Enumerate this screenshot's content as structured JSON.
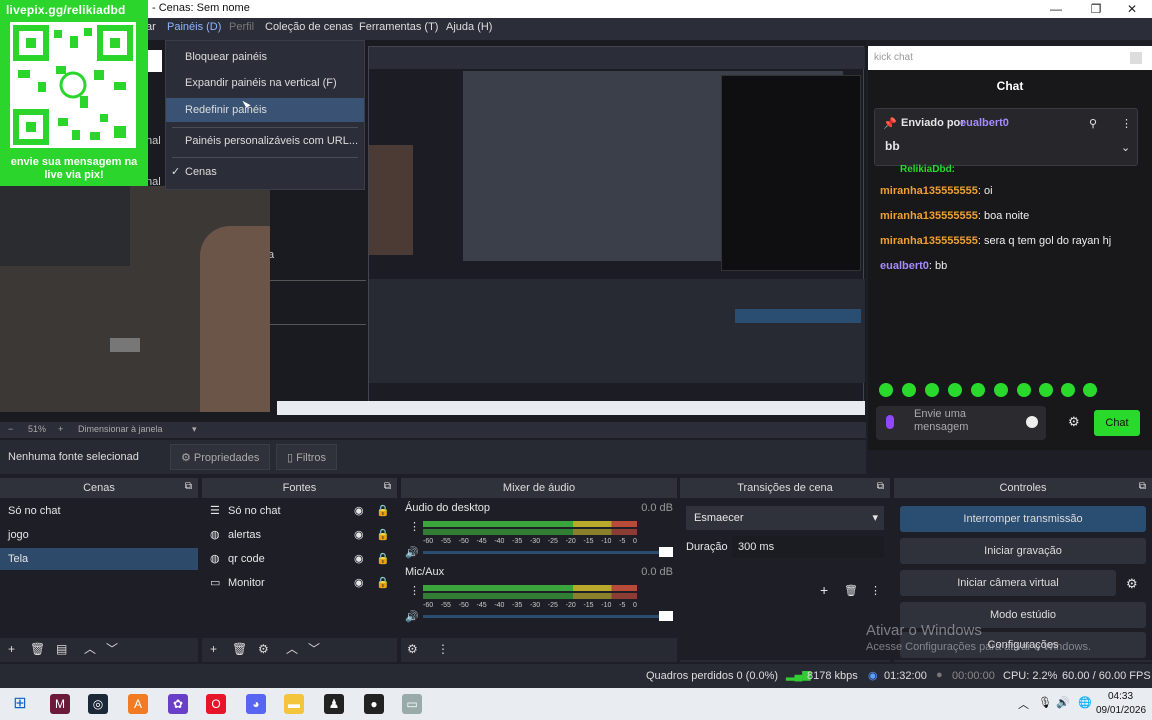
{
  "window": {
    "title": "- Cenas: Sem nome",
    "minimize": "—",
    "maximize": "❐",
    "close": "✕"
  },
  "menubar": {
    "items": [
      "ar",
      "Painéis (D)",
      "Perfil",
      "Coleção de cenas",
      "Ferramentas (T)",
      "Ajuda (H)"
    ]
  },
  "paneis_menu": {
    "items": [
      "Bloquear painéis",
      "Expandir painéis na vertical (F)",
      "Redefinir painéis",
      "Painéis personalizáveis com URL...",
      "Cenas"
    ],
    "check": "✓"
  },
  "qr_overlay": {
    "url": "livepix.gg/relikiadbd",
    "message": "envie sua mensagem na live via pix!"
  },
  "preview": {
    "left_labels": [
      "nal",
      "nal",
      "a"
    ]
  },
  "chat": {
    "search": "kick chat",
    "title": "Chat",
    "pinned_prefix": "Enviado por",
    "pinned_user": "eualbert0",
    "pinned_text": "bb",
    "partial_user": "RelikiaDbd:",
    "messages": [
      {
        "user": "miranha135555555",
        "text": ": oi",
        "color": "#f0a030"
      },
      {
        "user": "miranha135555555",
        "text": ": boa noite",
        "color": "#f0a030"
      },
      {
        "user": "miranha135555555",
        "text": ": sera q tem gol do rayan hj",
        "color": "#f0a030"
      },
      {
        "user": "eualbert0",
        "text": ": bb",
        "color": "#a58bff"
      }
    ],
    "input_placeholder": "Envie uma mensagem",
    "send": "Chat"
  },
  "zoom": {
    "minus": "−",
    "value": "51%",
    "plus": "+",
    "mode": "Dimensionar à janela"
  },
  "source_bar": {
    "status": "Nenhuma fonte selecionad",
    "properties": "Propriedades",
    "filters": "Filtros"
  },
  "scenes": {
    "title": "Cenas",
    "items": [
      "Só no chat",
      "jogo",
      "Tela"
    ]
  },
  "sources": {
    "title": "Fontes",
    "items": [
      "Só no chat",
      "alertas",
      "qr code",
      "Monitor"
    ]
  },
  "mixer": {
    "title": "Mixer de áudio",
    "channels": [
      {
        "name": "Áudio do desktop",
        "db": "0.0 dB",
        "level": 0.54
      },
      {
        "name": "Mic/Aux",
        "db": "0.0 dB",
        "level": 0.44
      }
    ],
    "ticks": [
      "-60",
      "-55",
      "-50",
      "-45",
      "-40",
      "-35",
      "-30",
      "-25",
      "-20",
      "-15",
      "-10",
      "-5",
      "0"
    ]
  },
  "transitions": {
    "title": "Transições de cena",
    "selected": "Esmaecer",
    "duration_label": "Duração",
    "duration": "300 ms"
  },
  "controls": {
    "title": "Controles",
    "buttons": [
      "Interromper transmissão",
      "Iniciar gravação",
      "Iniciar câmera virtual",
      "Modo estúdio",
      "Configurações"
    ]
  },
  "statusbar": {
    "dropped": "Quadros perdidos 0 (0.0%)",
    "bitrate": "8178 kbps",
    "live_time": "01:32:00",
    "rec_time": "00:00:00",
    "cpu": "CPU: 2.2%",
    "fps": "60.00 / 60.00 FPS"
  },
  "watermark": {
    "line1": "Ativar o Windows",
    "line2": "Acesse Configurações para ativar o Windows."
  },
  "taskbar": {
    "time": "04:33",
    "date": "09/01/2026"
  },
  "colors": {
    "accent": "#2a4d72",
    "chat_green": "#29d92c",
    "username_orange": "#f0a030",
    "username_purple": "#a58bff"
  }
}
